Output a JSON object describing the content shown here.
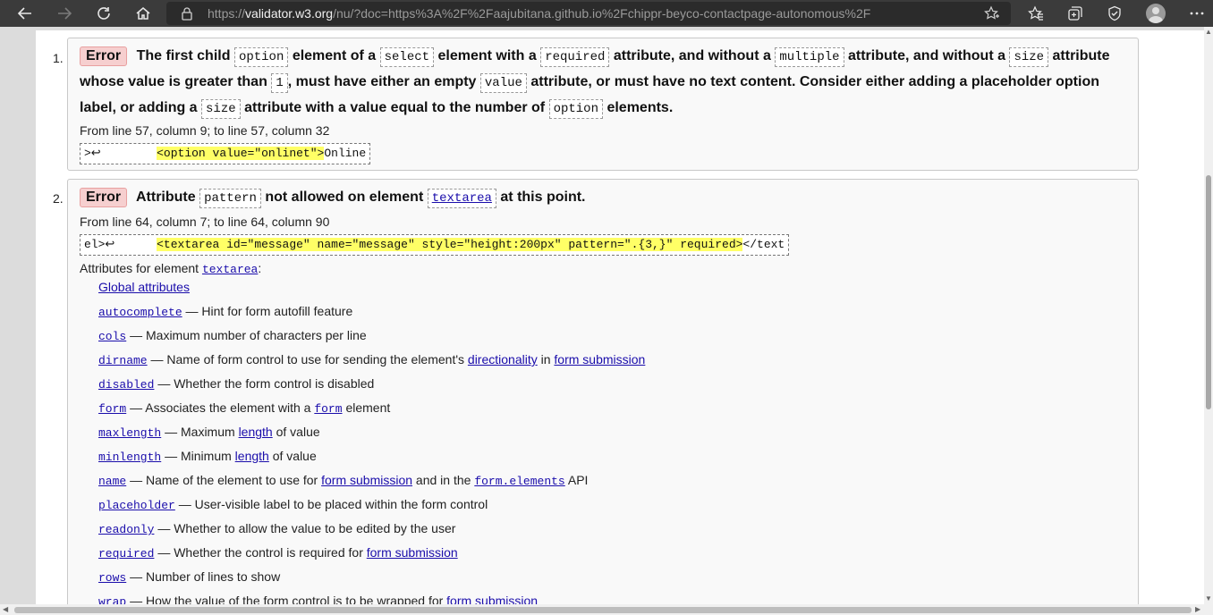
{
  "browser": {
    "url_scheme": "https://",
    "url_host": "validator.w3.org",
    "url_rest": "/nu/?doc=https%3A%2F%2Faajubitana.github.io%2Fchippr-beyco-contactpage-autonomous%2F",
    "icons": [
      "back-icon",
      "forward-icon",
      "refresh-icon",
      "home-icon",
      "lock-icon",
      "add-favorite-icon",
      "favorites-icon",
      "collections-icon",
      "browser-essentials-icon",
      "profile-avatar",
      "more-icon"
    ]
  },
  "errors": [
    {
      "number": "1.",
      "badge": "Error",
      "location": "From line 57, column 9; to line 57, column 32",
      "extract_prefix": ">↩        ",
      "extract_highlight": "<option value=\"onlinet\">",
      "extract_suffix": "Online"
    },
    {
      "number": "2.",
      "badge": "Error",
      "location": "From line 64, column 7; to line 64, column 90",
      "extract_prefix": "el>↩      ",
      "extract_highlight": "<textarea id=\"message\" name=\"message\" style=\"height:200px\" pattern=\".{3,}\" required>",
      "extract_suffix": "</text"
    }
  ],
  "error1_msg": {
    "t1": "The first child",
    "c1": "option",
    "t2": "element of a",
    "c2": "select",
    "t3": "element with a",
    "c3": "required",
    "t4": "attribute, and without a",
    "c4": "multiple",
    "t5": "attribute, and without a",
    "c5": "size",
    "t6": "attribute whose value is greater than",
    "c6": "1",
    "t7": ", must have either an empty",
    "c7": "value",
    "t8": "attribute, or must have no text content. Consider either adding a placeholder option label, or adding a",
    "c8": "size",
    "t9": "attribute with a value equal to the number of",
    "c9": "option",
    "t10": "elements."
  },
  "error2_msg": {
    "t1": "Attribute",
    "c1": "pattern",
    "t2": "not allowed on element",
    "c2": "textarea",
    "t3": "at this point."
  },
  "attributes_title": "Attributes for element",
  "attributes_title_element": "textarea",
  "attributes_title_colon": ":",
  "attributes": {
    "global": "Global attributes",
    "autocomplete": {
      "name": "autocomplete",
      "desc": "— Hint for form autofill feature"
    },
    "cols": {
      "name": "cols",
      "desc": "— Maximum number of characters per line"
    },
    "dirname": {
      "name": "dirname",
      "desc1": "— Name of form control to use for sending the element's",
      "link1": "directionality",
      "mid": "in",
      "link2": "form submission"
    },
    "disabled": {
      "name": "disabled",
      "desc": "— Whether the form control is disabled"
    },
    "form": {
      "name": "form",
      "desc1": "— Associates the element with a",
      "link": "form",
      "desc2": "element"
    },
    "maxlength": {
      "name": "maxlength",
      "desc1": "— Maximum",
      "link": "length",
      "desc2": "of value"
    },
    "minlength": {
      "name": "minlength",
      "desc1": "— Minimum",
      "link": "length",
      "desc2": "of value"
    },
    "name": {
      "name": "name",
      "desc1": "— Name of the element to use for",
      "link1": "form submission",
      "mid": "and in the",
      "link2": "form.elements",
      "desc2": "API"
    },
    "placeholder": {
      "name": "placeholder",
      "desc": "— User-visible label to be placed within the form control"
    },
    "readonly": {
      "name": "readonly",
      "desc": "— Whether to allow the value to be edited by the user"
    },
    "required": {
      "name": "required",
      "desc1": "— Whether the control is required for",
      "link": "form submission"
    },
    "rows": {
      "name": "rows",
      "desc": "— Number of lines to show"
    },
    "wrap": {
      "name": "wrap",
      "desc1": "— How the value of the form control is to be wrapped for",
      "link": "form submission"
    }
  }
}
